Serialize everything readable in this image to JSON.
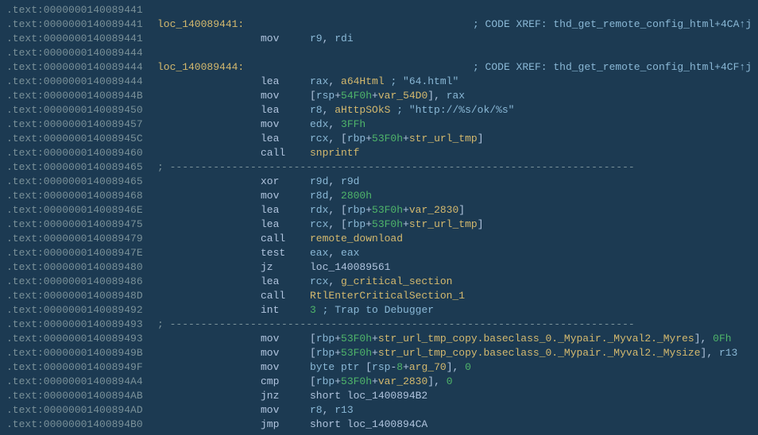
{
  "lines": [
    {
      "addr": ".text:0000000140089441",
      "label": "",
      "mnem": "",
      "ops": []
    },
    {
      "addr": ".text:0000000140089441",
      "label": "loc_140089441:",
      "mnem": "",
      "ops": [],
      "xref": "; CODE XREF: thd_get_remote_config_html+4CA↑j"
    },
    {
      "addr": ".text:0000000140089441",
      "label": "",
      "mnem": "mov",
      "ops": [
        {
          "t": "reg",
          "v": "r9"
        },
        {
          "t": "p",
          "v": ", "
        },
        {
          "t": "reg",
          "v": "rdi"
        }
      ]
    },
    {
      "addr": ".text:0000000140089444",
      "label": "",
      "mnem": "",
      "ops": []
    },
    {
      "addr": ".text:0000000140089444",
      "label": "loc_140089444:",
      "mnem": "",
      "ops": [],
      "xref": "; CODE XREF: thd_get_remote_config_html+4CF↑j"
    },
    {
      "addr": ".text:0000000140089444",
      "label": "",
      "mnem": "lea",
      "ops": [
        {
          "t": "reg",
          "v": "rax"
        },
        {
          "t": "p",
          "v": ", "
        },
        {
          "t": "func",
          "v": "a64Html"
        }
      ],
      "cmnt_spaces": 15,
      "cmnt": "; \"64.html\""
    },
    {
      "addr": ".text:000000014008944B",
      "label": "",
      "mnem": "mov",
      "ops": [
        {
          "t": "p",
          "v": "["
        },
        {
          "t": "reg",
          "v": "rsp"
        },
        {
          "t": "p",
          "v": "+"
        },
        {
          "t": "num",
          "v": "54F0h"
        },
        {
          "t": "p",
          "v": "+"
        },
        {
          "t": "func",
          "v": "var_54D0"
        },
        {
          "t": "p",
          "v": "], "
        },
        {
          "t": "reg",
          "v": "rax"
        }
      ]
    },
    {
      "addr": ".text:0000000140089450",
      "label": "",
      "mnem": "lea",
      "ops": [
        {
          "t": "reg",
          "v": "r8"
        },
        {
          "t": "p",
          "v": ", "
        },
        {
          "t": "func",
          "v": "aHttpSOkS"
        }
      ],
      "cmnt_spaces": 14,
      "cmnt": "; \"http://%s/ok/%s\""
    },
    {
      "addr": ".text:0000000140089457",
      "label": "",
      "mnem": "mov",
      "ops": [
        {
          "t": "reg",
          "v": "edx"
        },
        {
          "t": "p",
          "v": ", "
        },
        {
          "t": "num",
          "v": "3FFh"
        }
      ]
    },
    {
      "addr": ".text:000000014008945C",
      "label": "",
      "mnem": "lea",
      "ops": [
        {
          "t": "reg",
          "v": "rcx"
        },
        {
          "t": "p",
          "v": ", ["
        },
        {
          "t": "reg",
          "v": "rbp"
        },
        {
          "t": "p",
          "v": "+"
        },
        {
          "t": "num",
          "v": "53F0h"
        },
        {
          "t": "p",
          "v": "+"
        },
        {
          "t": "func",
          "v": "str_url_tmp"
        },
        {
          "t": "p",
          "v": "]"
        }
      ]
    },
    {
      "addr": ".text:0000000140089460",
      "label": "",
      "mnem": "call",
      "ops": [
        {
          "t": "func",
          "v": "snprintf"
        }
      ]
    },
    {
      "addr": ".text:0000000140089465",
      "sep": true
    },
    {
      "addr": ".text:0000000140089465",
      "label": "",
      "mnem": "xor",
      "ops": [
        {
          "t": "reg",
          "v": "r9d"
        },
        {
          "t": "p",
          "v": ", "
        },
        {
          "t": "reg",
          "v": "r9d"
        }
      ]
    },
    {
      "addr": ".text:0000000140089468",
      "label": "",
      "mnem": "mov",
      "ops": [
        {
          "t": "reg",
          "v": "r8d"
        },
        {
          "t": "p",
          "v": ", "
        },
        {
          "t": "num",
          "v": "2800h"
        }
      ]
    },
    {
      "addr": ".text:000000014008946E",
      "label": "",
      "mnem": "lea",
      "ops": [
        {
          "t": "reg",
          "v": "rdx"
        },
        {
          "t": "p",
          "v": ", ["
        },
        {
          "t": "reg",
          "v": "rbp"
        },
        {
          "t": "p",
          "v": "+"
        },
        {
          "t": "num",
          "v": "53F0h"
        },
        {
          "t": "p",
          "v": "+"
        },
        {
          "t": "func",
          "v": "var_2830"
        },
        {
          "t": "p",
          "v": "]"
        }
      ]
    },
    {
      "addr": ".text:0000000140089475",
      "label": "",
      "mnem": "lea",
      "ops": [
        {
          "t": "reg",
          "v": "rcx"
        },
        {
          "t": "p",
          "v": ", ["
        },
        {
          "t": "reg",
          "v": "rbp"
        },
        {
          "t": "p",
          "v": "+"
        },
        {
          "t": "num",
          "v": "53F0h"
        },
        {
          "t": "p",
          "v": "+"
        },
        {
          "t": "func",
          "v": "str_url_tmp"
        },
        {
          "t": "p",
          "v": "]"
        }
      ]
    },
    {
      "addr": ".text:0000000140089479",
      "label": "",
      "mnem": "call",
      "ops": [
        {
          "t": "func",
          "v": "remote_download"
        }
      ]
    },
    {
      "addr": ".text:000000014008947E",
      "label": "",
      "mnem": "test",
      "ops": [
        {
          "t": "reg",
          "v": "eax"
        },
        {
          "t": "p",
          "v": ", "
        },
        {
          "t": "reg",
          "v": "eax"
        }
      ]
    },
    {
      "addr": ".text:0000000140089480",
      "label": "",
      "mnem": "jz",
      "ops": [
        {
          "t": "str",
          "v": "loc_140089561"
        }
      ]
    },
    {
      "addr": ".text:0000000140089486",
      "label": "",
      "mnem": "lea",
      "ops": [
        {
          "t": "reg",
          "v": "rcx"
        },
        {
          "t": "p",
          "v": ", "
        },
        {
          "t": "func",
          "v": "g_critical_section"
        }
      ]
    },
    {
      "addr": ".text:000000014008948D",
      "label": "",
      "mnem": "call",
      "ops": [
        {
          "t": "func",
          "v": "RtlEnterCriticalSection_1"
        }
      ]
    },
    {
      "addr": ".text:0000000140089492",
      "label": "",
      "mnem": "int",
      "ops": [
        {
          "t": "num",
          "v": "3"
        }
      ],
      "cmnt_spaces": 26,
      "cmnt": "; Trap to Debugger"
    },
    {
      "addr": ".text:0000000140089493",
      "sep": true
    },
    {
      "addr": ".text:0000000140089493",
      "label": "",
      "mnem": "mov",
      "ops": [
        {
          "t": "p",
          "v": "["
        },
        {
          "t": "reg",
          "v": "rbp"
        },
        {
          "t": "p",
          "v": "+"
        },
        {
          "t": "num",
          "v": "53F0h"
        },
        {
          "t": "p",
          "v": "+"
        },
        {
          "t": "func",
          "v": "str_url_tmp_copy.baseclass_0._Mypair._Myval2._Myres"
        },
        {
          "t": "p",
          "v": "], "
        },
        {
          "t": "num",
          "v": "0Fh"
        }
      ]
    },
    {
      "addr": ".text:000000014008949B",
      "label": "",
      "mnem": "mov",
      "ops": [
        {
          "t": "p",
          "v": "["
        },
        {
          "t": "reg",
          "v": "rbp"
        },
        {
          "t": "p",
          "v": "+"
        },
        {
          "t": "num",
          "v": "53F0h"
        },
        {
          "t": "p",
          "v": "+"
        },
        {
          "t": "func",
          "v": "str_url_tmp_copy.baseclass_0._Mypair._Myval2._Mysize"
        },
        {
          "t": "p",
          "v": "], "
        },
        {
          "t": "reg",
          "v": "r13"
        }
      ]
    },
    {
      "addr": ".text:000000014008949F",
      "label": "",
      "mnem": "mov",
      "ops": [
        {
          "t": "reg",
          "v": "byte ptr"
        },
        {
          "t": "p",
          "v": " ["
        },
        {
          "t": "reg",
          "v": "rsp"
        },
        {
          "t": "p",
          "v": "-"
        },
        {
          "t": "num",
          "v": "8"
        },
        {
          "t": "p",
          "v": "+"
        },
        {
          "t": "func",
          "v": "arg_70"
        },
        {
          "t": "p",
          "v": "], "
        },
        {
          "t": "num",
          "v": "0"
        }
      ]
    },
    {
      "addr": ".text:00000001400894A4",
      "label": "",
      "mnem": "cmp",
      "ops": [
        {
          "t": "p",
          "v": "["
        },
        {
          "t": "reg",
          "v": "rbp"
        },
        {
          "t": "p",
          "v": "+"
        },
        {
          "t": "num",
          "v": "53F0h"
        },
        {
          "t": "p",
          "v": "+"
        },
        {
          "t": "func",
          "v": "var_2830"
        },
        {
          "t": "p",
          "v": "], "
        },
        {
          "t": "num",
          "v": "0"
        }
      ]
    },
    {
      "addr": ".text:00000001400894AB",
      "label": "",
      "mnem": "jnz",
      "ops": [
        {
          "t": "str",
          "v": "short loc_1400894B2"
        }
      ]
    },
    {
      "addr": ".text:00000001400894AD",
      "label": "",
      "mnem": "mov",
      "ops": [
        {
          "t": "reg",
          "v": "r8"
        },
        {
          "t": "p",
          "v": ", "
        },
        {
          "t": "reg",
          "v": "r13"
        }
      ]
    },
    {
      "addr": ".text:00000001400894B0",
      "label": "",
      "mnem": "jmp",
      "ops": [
        {
          "t": "str",
          "v": "short loc_1400894CA"
        }
      ]
    }
  ],
  "sep_text": "; ---------------------------------------------------------------------------"
}
